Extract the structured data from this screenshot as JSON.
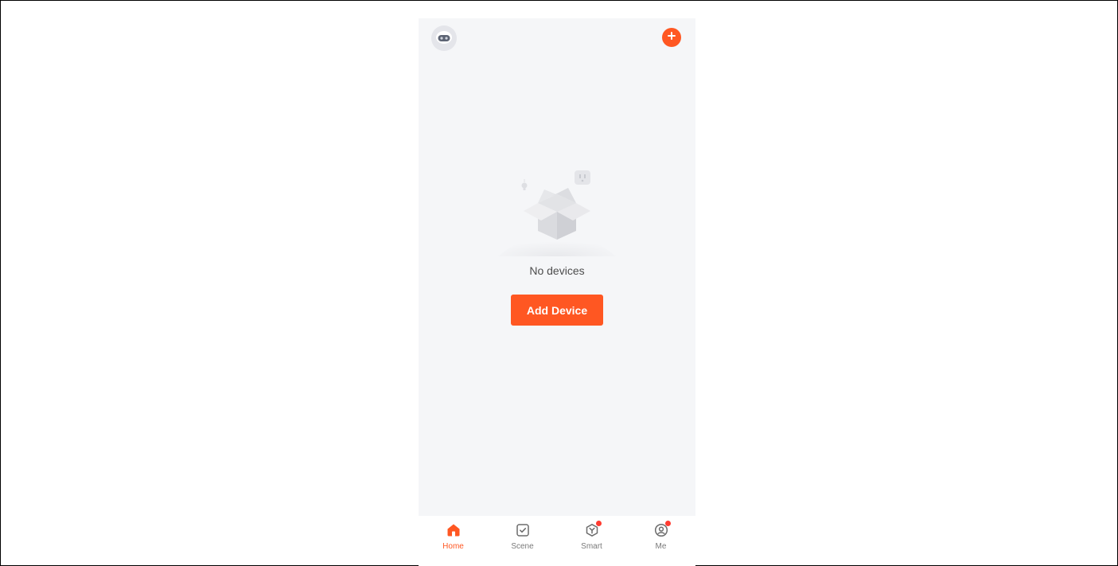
{
  "header": {
    "avatar_icon": "robot-avatar-icon",
    "add_icon": "plus-circle-icon"
  },
  "empty_state": {
    "illustration": "empty-box-illustration",
    "message": "No devices",
    "button_label": "Add Device"
  },
  "tabbar": {
    "tabs": [
      {
        "label": "Home",
        "icon": "home-icon",
        "active": true,
        "badge": false
      },
      {
        "label": "Scene",
        "icon": "scene-checkbox-icon",
        "active": false,
        "badge": false
      },
      {
        "label": "Smart",
        "icon": "smart-cube-icon",
        "active": false,
        "badge": true
      },
      {
        "label": "Me",
        "icon": "profile-icon",
        "active": false,
        "badge": true
      }
    ]
  },
  "colors": {
    "accent": "#ff5722",
    "badge": "#ff3b30",
    "background": "#f5f6f8",
    "tab_inactive": "#7a7a7a"
  }
}
